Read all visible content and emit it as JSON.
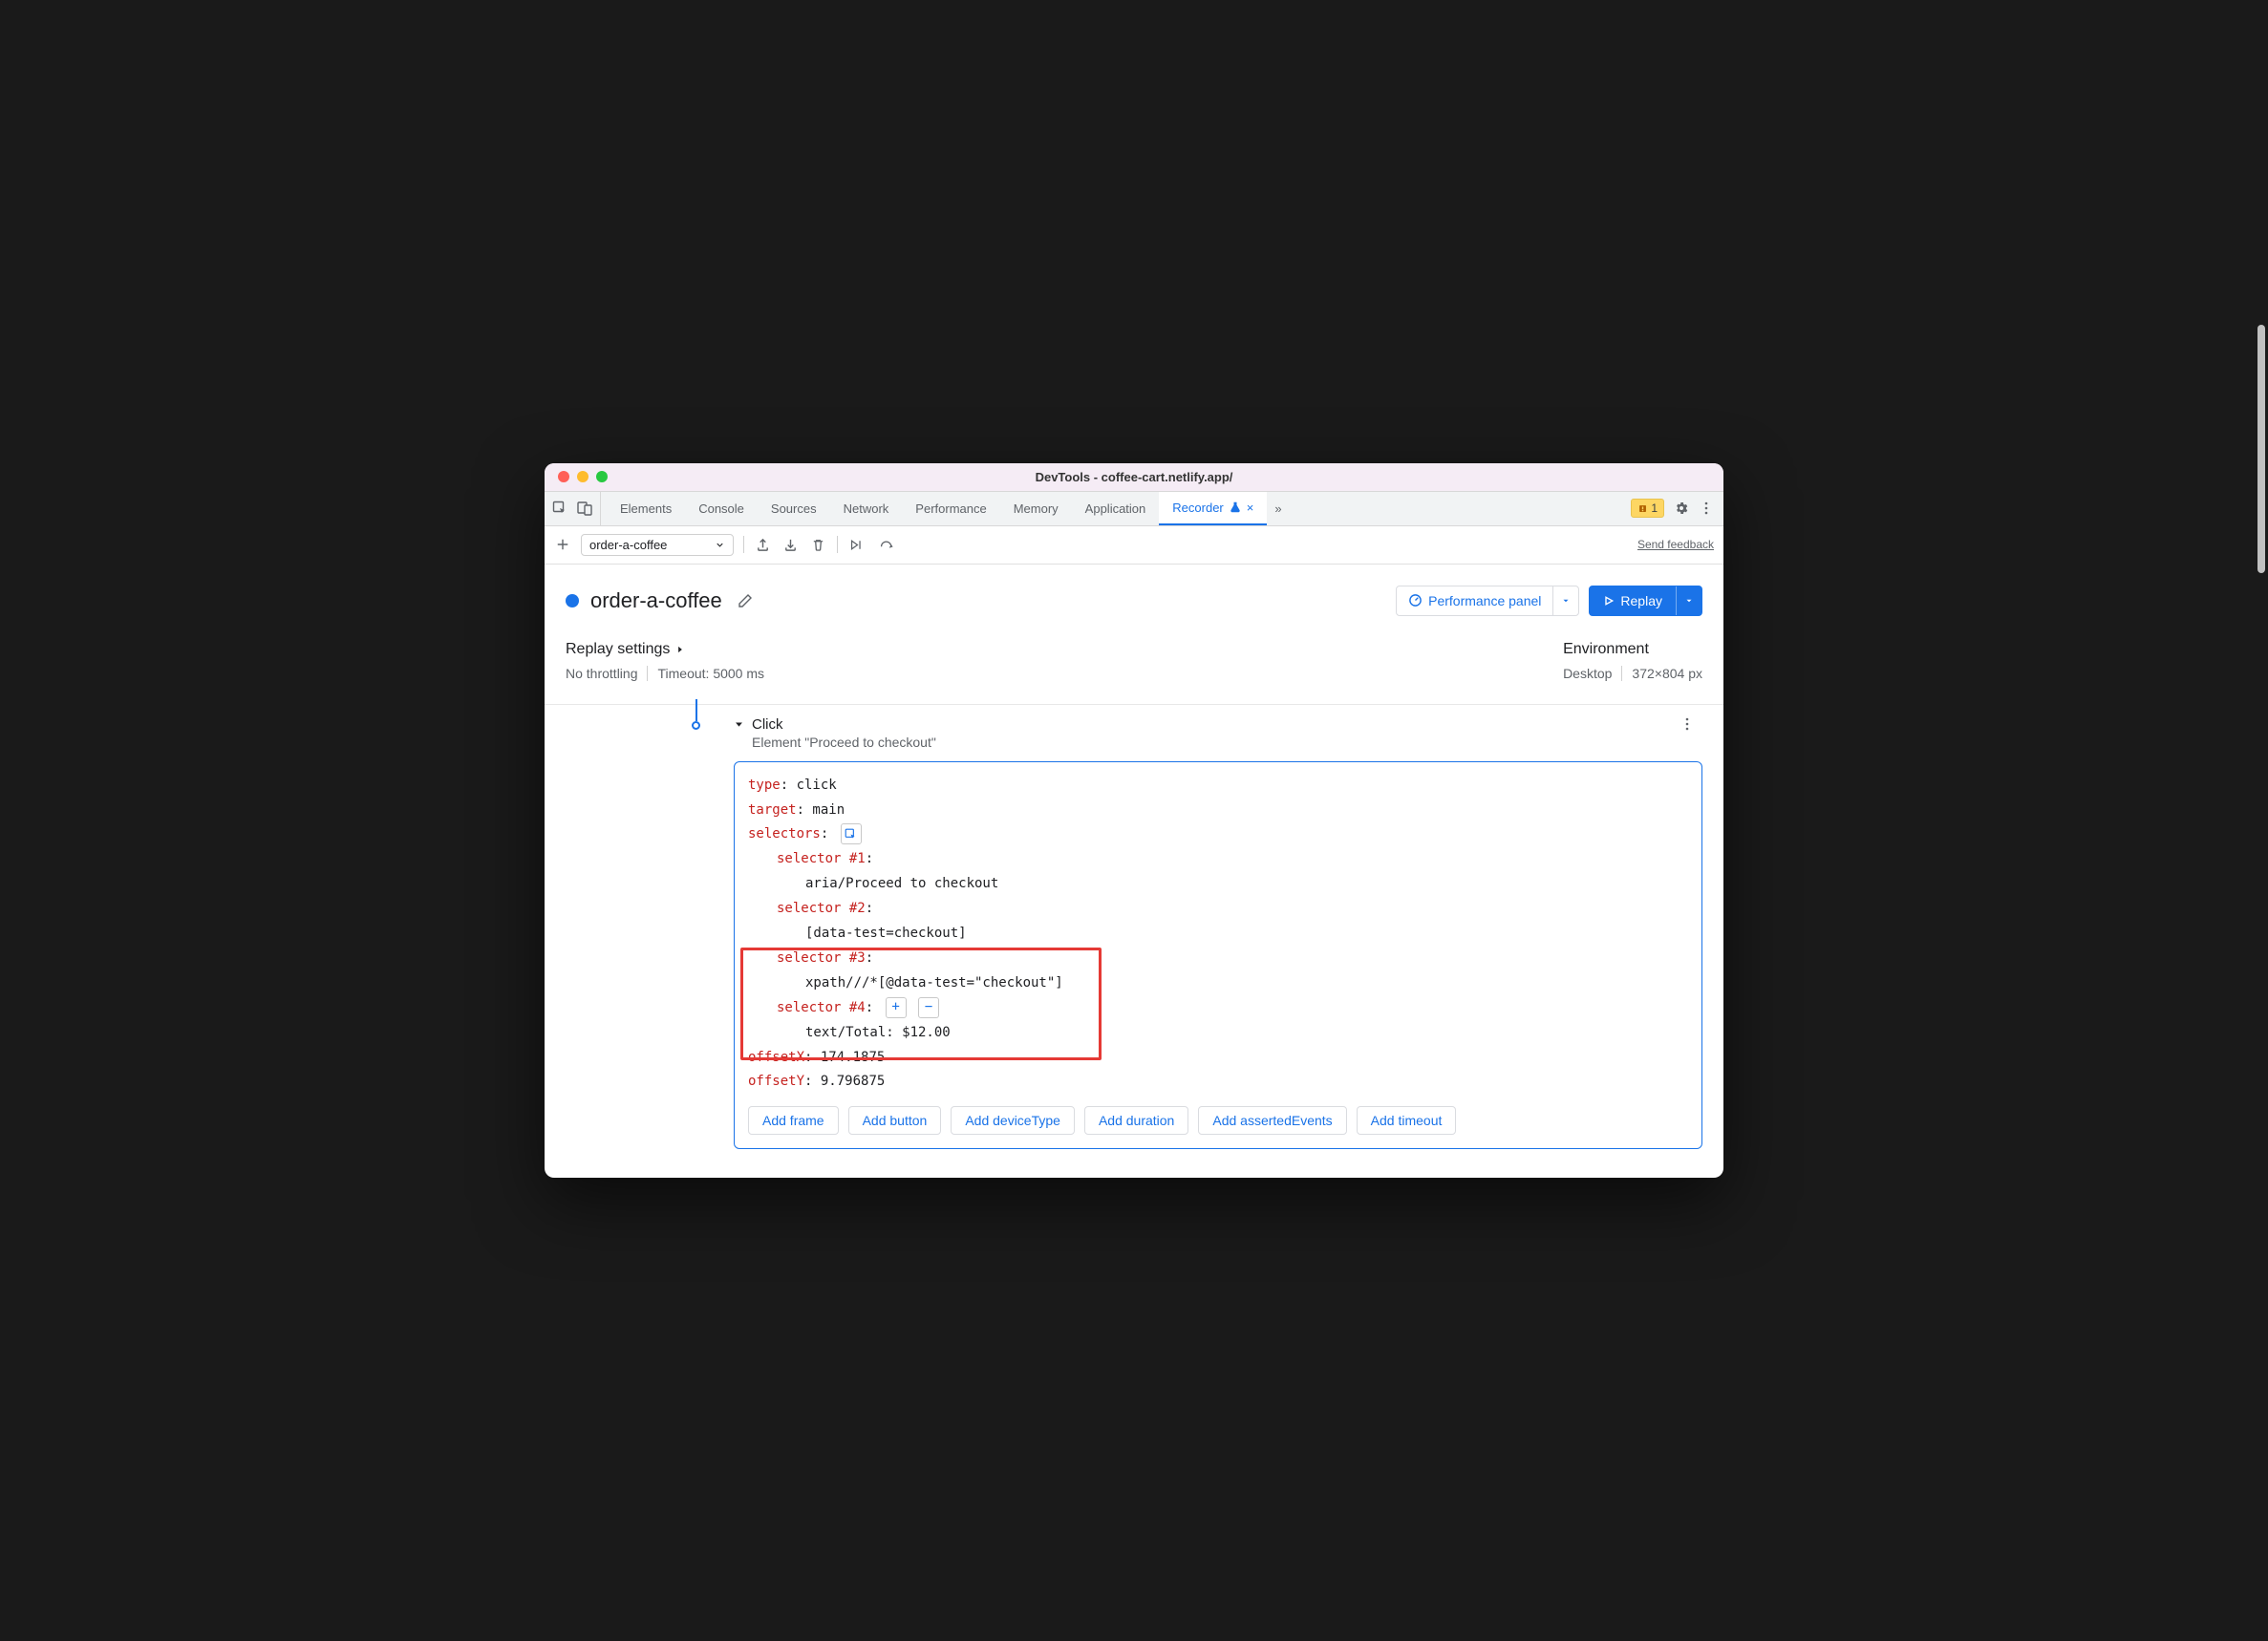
{
  "window": {
    "title": "DevTools - coffee-cart.netlify.app/"
  },
  "tabs": {
    "items": [
      "Elements",
      "Console",
      "Sources",
      "Network",
      "Performance",
      "Memory",
      "Application",
      "Recorder"
    ],
    "activeIndex": 7,
    "warningCount": "1"
  },
  "toolbar": {
    "recordingName": "order-a-coffee",
    "feedback": "Send feedback"
  },
  "header": {
    "title": "order-a-coffee",
    "perfPanel": "Performance panel",
    "replay": "Replay"
  },
  "settings": {
    "replayTitle": "Replay settings",
    "throttling": "No throttling",
    "timeout": "Timeout: 5000 ms",
    "envTitle": "Environment",
    "device": "Desktop",
    "dims": "372×804 px"
  },
  "step": {
    "name": "Click",
    "subtitle": "Element \"Proceed to checkout\"",
    "lines": {
      "typeKey": "type",
      "typeVal": ": click",
      "targetKey": "target",
      "targetVal": ": main",
      "selectorsKey": "selectors",
      "selectorsColon": ":",
      "sel1Key": "selector #1",
      "sel1Colon": ":",
      "sel1Val": "aria/Proceed to checkout",
      "sel2Key": "selector #2",
      "sel2Colon": ":",
      "sel2Val": "[data-test=checkout]",
      "sel3Key": "selector #3",
      "sel3Colon": ":",
      "sel3Val": "xpath///*[@data-test=\"checkout\"]",
      "sel4Key": "selector #4",
      "sel4Colon": ":",
      "sel4Val": "text/Total: $12.00",
      "offXKey": "offsetX",
      "offXVal": ": 174.1875",
      "offYKey": "offsetY",
      "offYVal": ": 9.796875"
    },
    "addButtons": [
      "Add frame",
      "Add button",
      "Add deviceType",
      "Add duration",
      "Add assertedEvents",
      "Add timeout"
    ]
  }
}
